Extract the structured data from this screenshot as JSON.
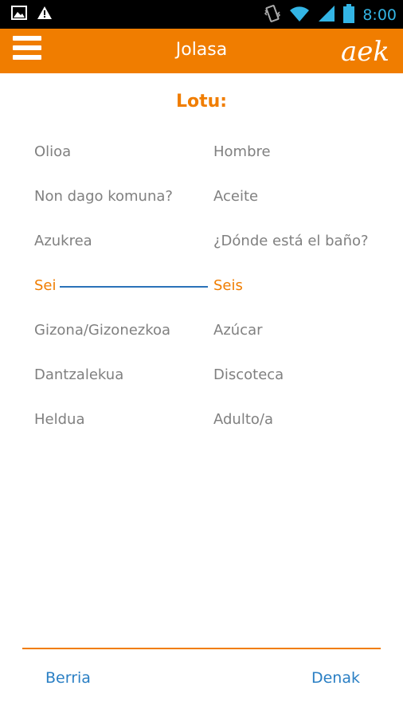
{
  "status_bar": {
    "time": "8:00",
    "icons": [
      "image-icon",
      "warning-icon",
      "vibrate-icon",
      "wifi-icon",
      "signal-icon",
      "battery-icon"
    ]
  },
  "app_bar": {
    "title": "Jolasa",
    "logo_text": "aek",
    "background": "#f07d00"
  },
  "game": {
    "heading": "Lotu:",
    "pairs": [
      {
        "left": "Olioa",
        "right": "Hombre",
        "matched": false
      },
      {
        "left": "Non dago komuna?",
        "right": "Aceite",
        "matched": false
      },
      {
        "left": "Azukrea",
        "right": "¿Dónde está el baño?",
        "matched": false
      },
      {
        "left": "Sei",
        "right": "Seis",
        "matched": true
      },
      {
        "left": "Gizona/Gizonezkoa",
        "right": "Azúcar",
        "matched": false
      },
      {
        "left": "Dantzalekua",
        "right": "Discoteca",
        "matched": false
      },
      {
        "left": "Heldua",
        "right": "Adulto/a",
        "matched": false
      }
    ]
  },
  "footer": {
    "new_label": "Berria",
    "all_label": "Denak"
  },
  "colors": {
    "accent": "#f07d00",
    "link": "#2a7fc4",
    "text": "#808080",
    "match_line": "#2a72b8"
  }
}
